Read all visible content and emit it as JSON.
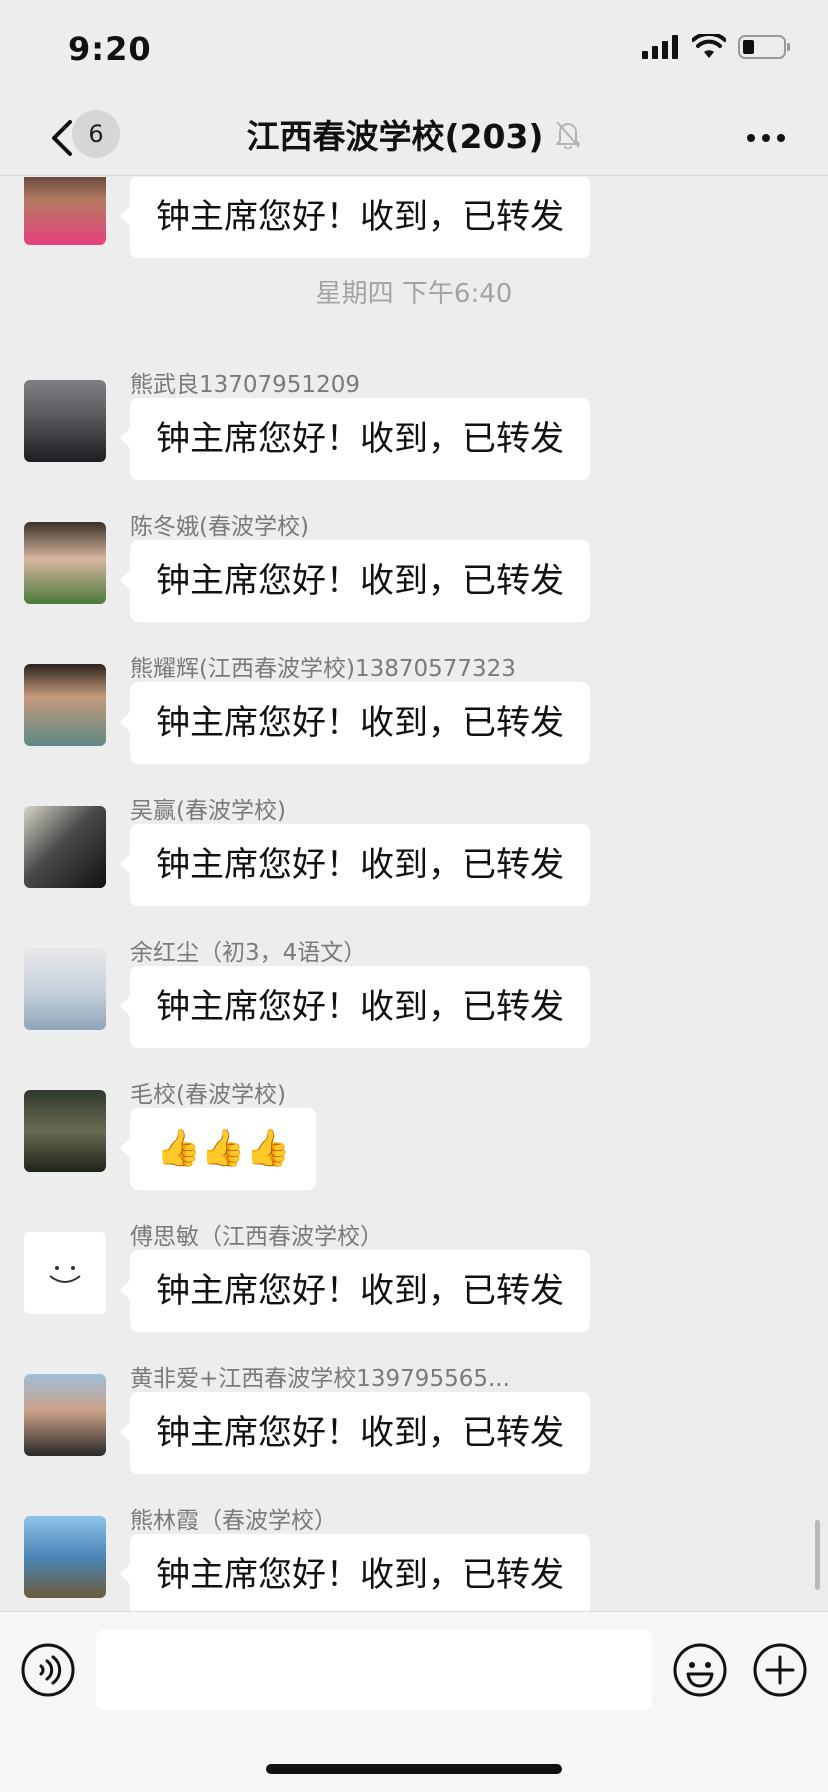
{
  "status_bar": {
    "time": "9:20"
  },
  "nav": {
    "unread_count": "6",
    "title": "江西春波学校(203)"
  },
  "chat": {
    "top_message": {
      "text": "钟主席您好！收到，已转发"
    },
    "time_separator": "星期四 下午6:40",
    "messages": [
      {
        "sender": "熊武良13707951209",
        "text": "钟主席您好！收到，已转发"
      },
      {
        "sender": "陈冬娥(春波学校)",
        "text": "钟主席您好！收到，已转发"
      },
      {
        "sender": "熊耀辉(江西春波学校)13870577323",
        "text": "钟主席您好！收到，已转发"
      },
      {
        "sender": "吴赢(春波学校)",
        "text": "钟主席您好！收到，已转发"
      },
      {
        "sender": "余红尘（初3，4语文）",
        "text": "钟主席您好！收到，已转发"
      },
      {
        "sender": "毛校(春波学校)",
        "text": "👍👍👍"
      },
      {
        "sender": "傅思敏（江西春波学校）",
        "text": "钟主席您好！收到，已转发"
      },
      {
        "sender": "黄非爱+江西春波学校139795565...",
        "text": "钟主席您好！收到，已转发"
      },
      {
        "sender": "熊林霞（春波学校）",
        "text": "钟主席您好！收到，已转发"
      }
    ]
  },
  "input": {
    "placeholder": ""
  },
  "icons": {
    "back": "chevron-left-icon",
    "mute": "bell-slash-icon",
    "more": "ellipsis-icon",
    "voice": "voice-icon",
    "emoji": "emoji-icon",
    "plus": "plus-icon"
  },
  "colors": {
    "background": "#ededed",
    "bubble": "#ffffff",
    "sender": "#7a7a7a",
    "time": "#a3a3a3"
  }
}
